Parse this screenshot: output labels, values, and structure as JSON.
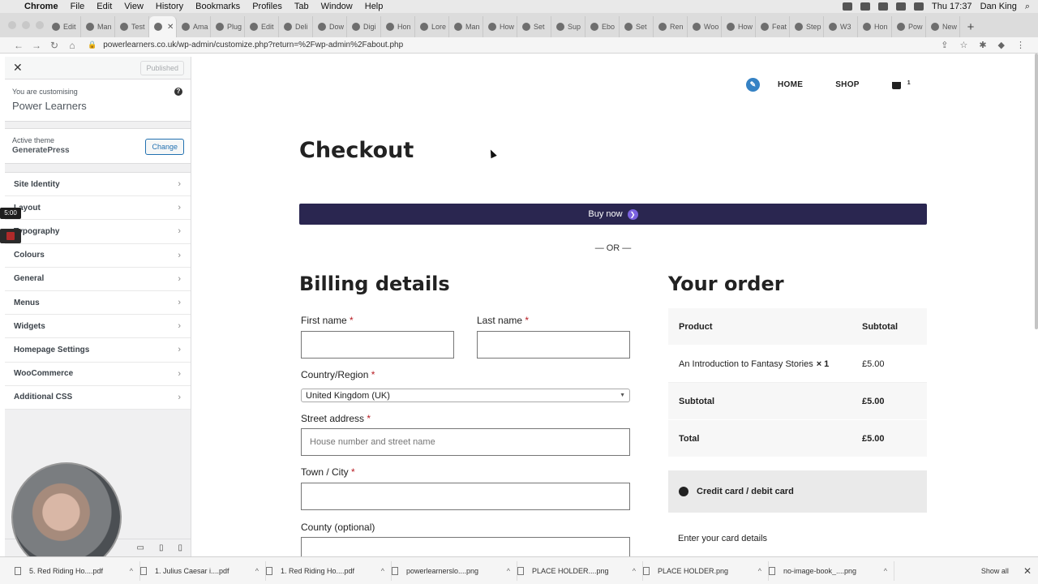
{
  "menubar": {
    "app": "Chrome",
    "items": [
      "File",
      "Edit",
      "View",
      "History",
      "Bookmarks",
      "Profiles",
      "Tab",
      "Window",
      "Help"
    ],
    "clock": "Thu 17:37",
    "user": "Dan King"
  },
  "tabs": [
    "Edit",
    "Man",
    "Test",
    "",
    "Ama",
    "Plug",
    "Edit",
    "Deli",
    "Dow",
    "Digi",
    "Hon",
    "Lore",
    "Man",
    "How",
    "Set",
    "Sup",
    "Ebo",
    "Set",
    "Ren",
    "Woo",
    "How",
    "Feat",
    "Step",
    "W3",
    "Hon",
    "Pow",
    "New"
  ],
  "address": {
    "url": "powerlearners.co.uk/wp-admin/customize.php?return=%2Fwp-admin%2Fabout.php"
  },
  "customizer": {
    "published_label": "Published",
    "customising_label": "You are customising",
    "site_name": "Power Learners",
    "active_theme_label": "Active theme",
    "theme_name": "GeneratePress",
    "change_label": "Change",
    "sections": [
      "Site Identity",
      "Layout",
      "Typography",
      "Colours",
      "General",
      "Menus",
      "Widgets",
      "Homepage Settings",
      "WooCommerce",
      "Additional CSS"
    ]
  },
  "recorder": {
    "timer": "5:00"
  },
  "page": {
    "nav": {
      "home": "HOME",
      "shop": "SHOP",
      "cart_count": "1"
    },
    "title": "Checkout",
    "buy_now": "Buy now",
    "or": "— OR —",
    "billing_heading": "Billing details",
    "first_name_label": "First name",
    "last_name_label": "Last name",
    "country_label": "Country/Region",
    "country_value": "United Kingdom (UK)",
    "street_label": "Street address",
    "street_placeholder": "House number and street name",
    "town_label": "Town / City",
    "county_label": "County (optional)",
    "required_mark": "*",
    "order_heading": "Your order",
    "order": {
      "col_product": "Product",
      "col_subtotal": "Subtotal",
      "item_name": "An Introduction to Fantasy Stories",
      "item_qty": "× 1",
      "item_price": "£5.00",
      "subtotal_label": "Subtotal",
      "subtotal_value": "£5.00",
      "total_label": "Total",
      "total_value": "£5.00"
    },
    "payment_method": "Credit card / debit card",
    "card_details_label": "Enter your card details"
  },
  "downloads": {
    "items": [
      "5. Red Riding Ho....pdf",
      "1. Julius Caesar i....pdf",
      "1. Red Riding Ho....pdf",
      "powerlearnerslo....png",
      "PLACE HOLDER....png",
      "PLACE HOLDER.png",
      "no-image-book_....png"
    ],
    "show_all": "Show all"
  },
  "colors": {
    "buy_now_bg": "#2a2650",
    "accent": "#2271b1",
    "required": "#b81c23"
  }
}
